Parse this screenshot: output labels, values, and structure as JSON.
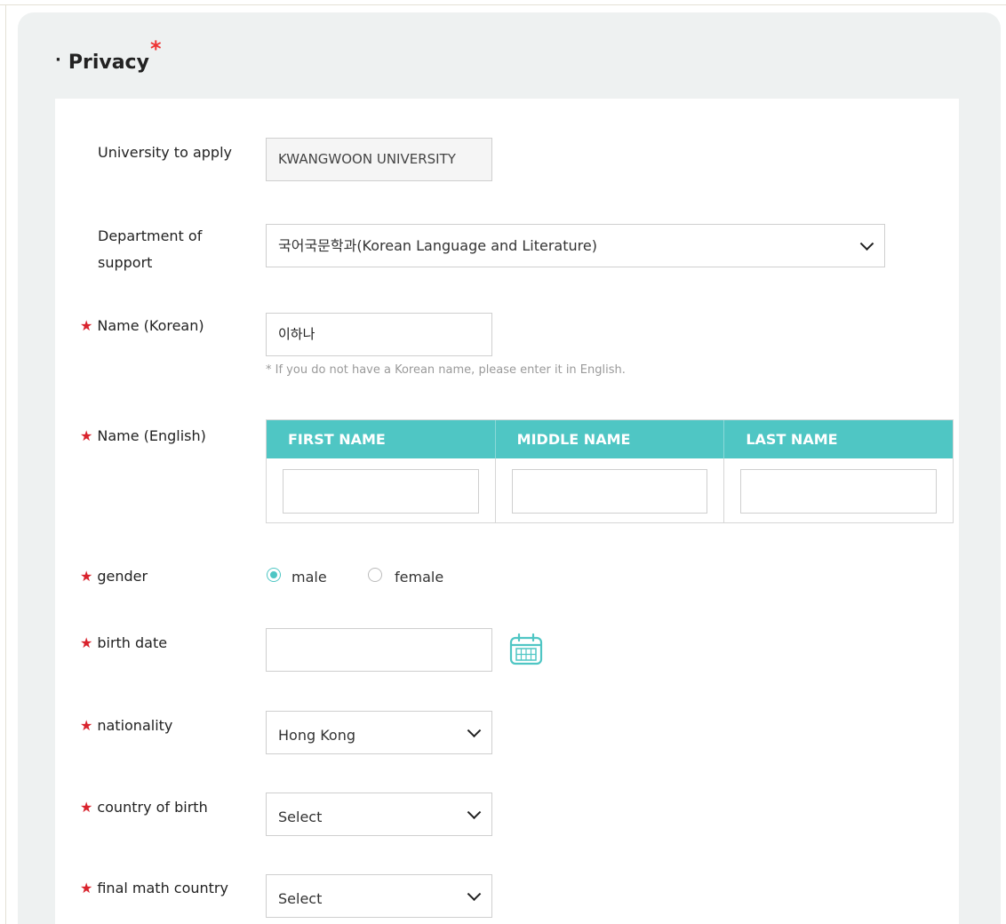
{
  "section": {
    "title": "Privacy",
    "required_mark": "*"
  },
  "fields": {
    "university": {
      "label": "University to apply",
      "value": "KWANGWOON UNIVERSITY"
    },
    "department": {
      "label_line1": "Department of",
      "label_line2": "support",
      "value": "국어국문학과(Korean Language and Literature)"
    },
    "name_korean": {
      "required": "★",
      "label": "Name (Korean)",
      "value": "이하나",
      "hint": "* If you do not have a Korean name, please enter it in English."
    },
    "name_english": {
      "required": "★",
      "label": "Name (English)",
      "columns": [
        "FIRST NAME",
        "MIDDLE NAME",
        "LAST NAME"
      ],
      "values": [
        "",
        "",
        ""
      ]
    },
    "gender": {
      "required": "★",
      "label": "gender",
      "options": [
        "male",
        "female"
      ],
      "selected": "male"
    },
    "birth_date": {
      "required": "★",
      "label": "birth date",
      "value": "",
      "icon": "calendar-icon"
    },
    "nationality": {
      "required": "★",
      "label": "nationality",
      "value": "Hong Kong"
    },
    "country_of_birth": {
      "required": "★",
      "label": "country of birth",
      "value": "Select"
    },
    "final_math_country": {
      "required": "★",
      "label": "final math country",
      "value": "Select"
    }
  },
  "colors": {
    "accent": "#4fc6c4",
    "required": "#d9232d",
    "panel_bg": "#eef1f1"
  }
}
